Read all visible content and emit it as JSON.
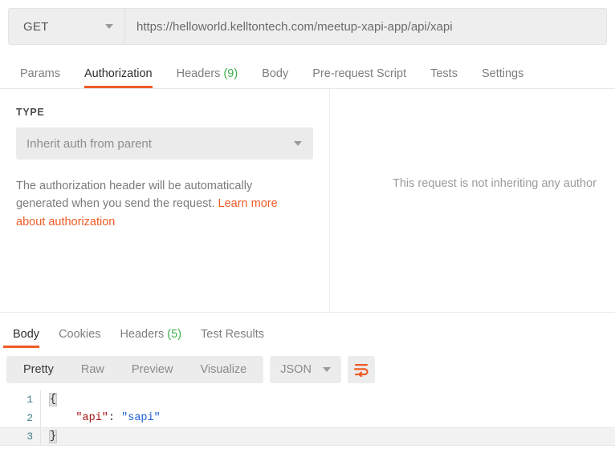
{
  "request_bar": {
    "method": "GET",
    "method_caret_icon": "chevron-down-icon",
    "url": "https://helloworld.kelltontech.com/meetup-xapi-app/api/xapi",
    "url_placeholder": "Enter request URL"
  },
  "request_tabs": [
    {
      "label": "Params",
      "count": "",
      "active": false
    },
    {
      "label": "Authorization",
      "count": "",
      "active": true
    },
    {
      "label": "Headers",
      "count": "(9)",
      "active": false
    },
    {
      "label": "Body",
      "count": "",
      "active": false
    },
    {
      "label": "Pre-request Script",
      "count": "",
      "active": false
    },
    {
      "label": "Tests",
      "count": "",
      "active": false
    },
    {
      "label": "Settings",
      "count": "",
      "active": false
    }
  ],
  "authorization": {
    "type_label": "TYPE",
    "selected_type": "Inherit auth from parent",
    "select_caret_icon": "chevron-down-icon",
    "description_text": "The authorization header will be automatically generated when you send the request. ",
    "description_link": "Learn more about authorization",
    "right_panel_message": "This request is not inheriting any author"
  },
  "response_tabs": [
    {
      "label": "Body",
      "count": "",
      "active": true
    },
    {
      "label": "Cookies",
      "count": "",
      "active": false
    },
    {
      "label": "Headers",
      "count": "(5)",
      "active": false
    },
    {
      "label": "Test Results",
      "count": "",
      "active": false
    }
  ],
  "format_toolbar": {
    "segments": [
      {
        "label": "Pretty",
        "active": true
      },
      {
        "label": "Raw",
        "active": false
      },
      {
        "label": "Preview",
        "active": false
      },
      {
        "label": "Visualize",
        "active": false
      }
    ],
    "format_value": "JSON",
    "format_caret_icon": "chevron-down-icon",
    "wrap_icon": "word-wrap-icon"
  },
  "response_body": {
    "lines": [
      {
        "number": "1",
        "open_brace": "{",
        "key": "",
        "colon": "",
        "value": "",
        "close_brace": ""
      },
      {
        "number": "2",
        "open_brace": "",
        "key": "\"api\"",
        "colon": ": ",
        "value": "\"sapi\"",
        "close_brace": ""
      },
      {
        "number": "3",
        "open_brace": "",
        "key": "",
        "colon": "",
        "value": "",
        "close_brace": "}"
      }
    ]
  },
  "colors": {
    "accent_orange": "#ef5b25",
    "count_green": "#3aaf4b",
    "json_key_red": "#a31515",
    "json_value_blue": "#1b5fd6",
    "gutter_teal": "#3f7c86"
  }
}
